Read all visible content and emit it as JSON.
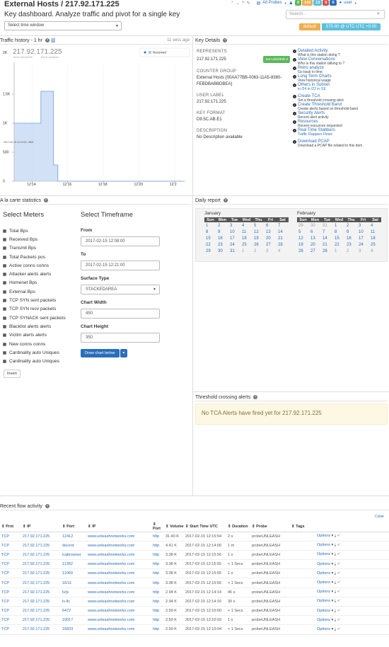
{
  "header": {
    "title": "External Hosts / 217.92.171.225",
    "subtitle": "Key dashboard. Analyze traffic and pivot for a single key",
    "time_window": "Select time window",
    "search_placeholder": "Search...",
    "nav": {
      "all_probes": "All Probes",
      "counts": [
        "0",
        "143",
        "13",
        "0",
        "0"
      ],
      "count_colors": [
        "#5cb85c",
        "#f0ad4e",
        "#5bc0de",
        "#d9534f",
        "#2a6ebb"
      ],
      "user": "user"
    },
    "interface_badge": "default",
    "time_badge": "570-90 @ UTC UTC +0:00"
  },
  "traffic": {
    "title": "Traffic history - 1 hr",
    "updated": "11 secs ago",
    "chart_data": {
      "type": "area",
      "title": "217.92.171.225",
      "subtitle_left": "Total bandwidth",
      "subtitle_right": "Burst analysis",
      "legend": [
        "Received"
      ],
      "ylabel_top": "2K",
      "yticks": [
        "1.5K",
        "1K",
        "500",
        "0"
      ],
      "ytick_values": [
        1500,
        1000,
        500,
        0
      ],
      "ylim": [
        0,
        2000
      ],
      "xticks": [
        "12:14",
        "12:16",
        "12:18",
        "12:20",
        "12:2"
      ],
      "xtick_minutes": [
        14,
        16,
        18,
        20,
        22
      ],
      "xaxis_detail": "2017-02-15 12:13:00 -0800",
      "series": [
        {
          "name": "Received",
          "x_minutes": [
            13.0,
            14.5,
            14.5,
            15.2,
            15.2,
            15.45,
            15.45,
            22.5
          ],
          "values": [
            1000,
            1000,
            1550,
            1550,
            280,
            280,
            0,
            0
          ]
        }
      ],
      "color": "#aec8ee"
    }
  },
  "key_details": {
    "title": "Key Details",
    "represents_label": "REPRESENTS",
    "represents_value": "217.92.171.225",
    "set_label_button": "Set Label/Edit",
    "counter_group_label": "COUNTER GROUP",
    "counter_group_value": "External Hosts {00AA77BB-0063-11A5-8380-FEBDBABBDBEA}",
    "user_label_label": "USER LABEL",
    "user_label_value": "217.92.171.225",
    "key_format_label": "KEY FORMAT",
    "key_format_value": "D9.5C.AB.E1",
    "description_label": "DESCRIPTION",
    "description_value": "No Description available",
    "actions": [
      {
        "label": "Detailed Activity",
        "desc": "What is this station doing ?"
      },
      {
        "label": "View Conversations",
        "desc": "Who is this station talking to ?"
      },
      {
        "label": "Retro analyze",
        "desc": "Go back in time"
      },
      {
        "label": "Long Term Charts",
        "desc": "View historical usage"
      },
      {
        "label": "Others in Subnet",
        "desc": "in /24   in /22   in /16"
      },
      {
        "label": "Create TCA",
        "desc": "Set a threshold crossing alert"
      },
      {
        "label": "Create Threshold Band",
        "desc": "Create alerts based on threshold band"
      },
      {
        "label": "Security Alerts",
        "desc": "Recent alert activity"
      },
      {
        "label": "Resources",
        "desc": "Recent resources requested"
      },
      {
        "label": "Real Time Stabbers",
        "desc": "Traffic   Flappers   Flows"
      },
      {
        "label": "Download PCAP",
        "desc": "Download a PCAP file related to this item"
      }
    ]
  },
  "alacarte": {
    "title": "A la carte statistics",
    "meters_heading": "Select Meters",
    "timeframe_heading": "Select Timeframe",
    "meters": [
      "Total Bps",
      "Received Bps",
      "Transmit Bps",
      "Total Packets pos",
      "Active conns conns",
      "Attacker alerts alerts",
      "Homenet Bps",
      "External Bps",
      "TCP SYN sent packets",
      "TCP SYN recv packets",
      "TCP SYNACK sent packets",
      "Blacklist alerts alerts",
      "Victim alerts alerts",
      "New conns conns",
      "Cardinality auto Uniques",
      "Cardinality auto Uniques"
    ],
    "invert_button": "Invert",
    "from_label": "From",
    "from_value": "2017-02-15 12:08:00",
    "to_label": "To",
    "to_value": "2017-02-15 12:21:00",
    "surface_label": "Surface Type",
    "surface_value": "STACKEDAREA",
    "width_label": "Chart Width",
    "width_value": "450",
    "height_label": "Chart Height",
    "height_value": "350",
    "draw_button": "Draw chart below"
  },
  "daily": {
    "title": "Daily report",
    "days": [
      "Sun",
      "Mon",
      "Tue",
      "Wed",
      "Thu",
      "Fri",
      "Sat"
    ],
    "january": {
      "name": "January",
      "rows": [
        [
          "1",
          "2",
          "3",
          "4",
          "5",
          "6",
          "7"
        ],
        [
          "8",
          "9",
          "10",
          "11",
          "12",
          "13",
          "14"
        ],
        [
          "15",
          "16",
          "17",
          "18",
          "19",
          "20",
          "21"
        ],
        [
          "22",
          "23",
          "24",
          "25",
          "26",
          "27",
          "28"
        ],
        [
          "29",
          "30",
          "31",
          "1",
          "2",
          "3",
          "4"
        ]
      ]
    },
    "february": {
      "name": "February",
      "rows": [
        [
          "29",
          "30",
          "31",
          "1",
          "2",
          "3",
          "4"
        ],
        [
          "5",
          "6",
          "7",
          "8",
          "9",
          "10",
          "11"
        ],
        [
          "12",
          "13",
          "14",
          "15",
          "16",
          "17",
          "18"
        ],
        [
          "19",
          "20",
          "21",
          "22",
          "23",
          "24",
          "25"
        ],
        [
          "26",
          "27",
          "28",
          "1",
          "2",
          "3",
          "4"
        ]
      ]
    }
  },
  "threshold": {
    "title": "Threshold crossing alerts",
    "message": "No TCA Alerts have fired yet for 217.92.171.225"
  },
  "flows": {
    "title": "Recent flow activity",
    "cols_button": "Cols",
    "headers": [
      "Prot",
      "IP",
      "Port",
      "IP",
      "Port",
      "Volume",
      "Start Time UTC",
      "Duration",
      "Probe",
      "Tags"
    ],
    "options_label": "Options",
    "rows": [
      [
        "TCP",
        "217.92.171.225",
        "12412",
        "www.unleashnetworks.com",
        "http",
        "31.40 K",
        "2017-02-15 12:15:54",
        "2 s",
        "probeUNLEASH"
      ],
      [
        "TCP",
        "217.92.171.225",
        "dscerd",
        "www.unleashnetworks.com",
        "http",
        "4.41 K",
        "2017-02-15 12:14:00",
        "1 m",
        "probeUNLEASH"
      ],
      [
        "TCP",
        "217.92.171.225",
        "icabrowser",
        "www.unleashnetworks.com",
        "http",
        "3.38 K",
        "2017-02-15 12:15:56",
        "1 s",
        "probeUNLEASH"
      ],
      [
        "TCP",
        "217.92.171.225",
        "11362",
        "www.unleashnetworks.com",
        "http",
        "3.38 K",
        "2017-02-15 12:15:55",
        "< 1 Secs",
        "probeUNLEASH"
      ],
      [
        "TCP",
        "217.92.171.225",
        "11069",
        "www.unleashnetworks.com",
        "http",
        "3.38 K",
        "2017-02-15 12:15:55",
        "1 s",
        "probeUNLEASH"
      ],
      [
        "TCP",
        "217.92.171.225",
        "16/11",
        "www.unleashnetworks.com",
        "http",
        "3.38 K",
        "2017-02-15 12:15:56",
        "< 1 Secs",
        "probeUNLEASH"
      ],
      [
        "TCP",
        "217.92.171.225",
        "lv/jc",
        "www.unleashnetworks.com",
        "http",
        "2.94 K",
        "2017-02-15 12:14:14",
        "46 s",
        "probeUNLEASH"
      ],
      [
        "TCP",
        "217.92.171.225",
        "lv-llc",
        "www.unleashnetworks.com",
        "http",
        "2.94 K",
        "2017-02-15 12:14:16",
        "30 s",
        "probeUNLEASH"
      ],
      [
        "TCP",
        "217.92.171.225",
        "6472",
        "www.unleashnetworks.com",
        "http",
        "2.59 K",
        "2017-02-15 12:10:00",
        "< 1 Secs",
        "probeUNLEASH"
      ],
      [
        "TCP",
        "217.92.171.225",
        "10017",
        "www.unleashnetworks.com",
        "http",
        "2.59 K",
        "2017-02-15 12:10:03",
        "1 s",
        "probeUNLEASH"
      ],
      [
        "TCP",
        "217.92.171.225",
        "15833",
        "www.unleashnetworks.com",
        "http",
        "2.59 K",
        "2017-02-15 12:10:04",
        "< 1 Secs",
        "probeUNLEASH"
      ]
    ]
  }
}
